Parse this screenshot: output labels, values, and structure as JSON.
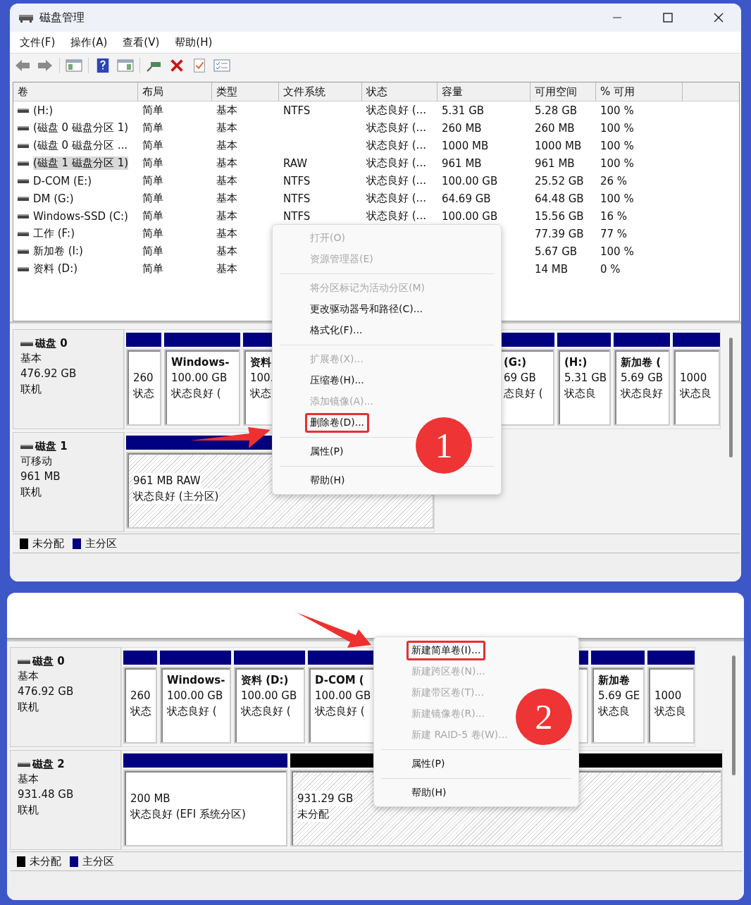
{
  "top_screenshot": {
    "window": {
      "title": "磁盘管理"
    },
    "menu_bar": [
      "文件(F)",
      "操作(A)",
      "查看(V)",
      "帮助(H)"
    ],
    "volume_table": {
      "columns": [
        "卷",
        "布局",
        "类型",
        "文件系统",
        "状态",
        "容量",
        "可用空间",
        "% 可用"
      ],
      "rows": [
        {
          "volume": "(H:)",
          "layout": "简单",
          "type": "基本",
          "file_system": "NTFS",
          "status": "状态良好 (...",
          "capacity": "5.31 GB",
          "free_space": "5.28 GB",
          "percent_free": "100 %",
          "selected": false
        },
        {
          "volume": "(磁盘 0 磁盘分区 1)",
          "layout": "简单",
          "type": "基本",
          "status": "状态良好 (...",
          "capacity": "260 MB",
          "free_space": "260 MB",
          "percent_free": "100 %",
          "selected": false
        },
        {
          "volume": "(磁盘 0 磁盘分区 ...",
          "layout": "简单",
          "type": "基本",
          "status": "状态良好 (...",
          "capacity": "1000 MB",
          "free_space": "1000 MB",
          "percent_free": "100 %",
          "selected": false
        },
        {
          "volume": "(磁盘 1 磁盘分区 1)",
          "layout": "简单",
          "type": "基本",
          "file_system": "RAW",
          "status": "状态良好 (...",
          "capacity": "961 MB",
          "free_space": "961 MB",
          "percent_free": "100 %",
          "selected": true
        },
        {
          "volume": "D-COM (E:)",
          "layout": "简单",
          "type": "基本",
          "file_system": "NTFS",
          "status": "状态良好 (...",
          "capacity": "100.00 GB",
          "free_space": "25.52 GB",
          "percent_free": "26 %",
          "selected": false
        },
        {
          "volume": "DM (G:)",
          "layout": "简单",
          "type": "基本",
          "file_system": "NTFS",
          "status": "状态良好 (...",
          "capacity": "64.69 GB",
          "free_space": "64.48 GB",
          "percent_free": "100 %",
          "selected": false
        },
        {
          "volume": "Windows-SSD (C:)",
          "layout": "简单",
          "type": "基本",
          "file_system": "NTFS",
          "status": "状态良好 (...",
          "capacity": "100.00 GB",
          "free_space": "15.56 GB",
          "percent_free": "16 %",
          "selected": false
        },
        {
          "volume": "工作 (F:)",
          "layout": "简单",
          "type": "基本",
          "free_space": "77.39 GB",
          "percent_free": "77 %",
          "selected": false
        },
        {
          "volume": "新加卷 (I:)",
          "layout": "简单",
          "type": "基本",
          "free_space": "5.67 GB",
          "percent_free": "100 %",
          "selected": false
        },
        {
          "volume": "资料 (D:)",
          "layout": "简单",
          "type": "基本",
          "free_space": "14 MB",
          "percent_free": "0 %",
          "selected": false
        }
      ]
    },
    "disks": [
      {
        "name": "磁盘 0",
        "type": "基本",
        "size": "476.92 GB",
        "status": "联机",
        "partitions": [
          {
            "kind": "primary",
            "selected": false,
            "size": "260",
            "status": "状态"
          },
          {
            "kind": "primary",
            "selected": false,
            "title": "Windows-",
            "size": "100.00 GB",
            "status": "状态良好 ("
          },
          {
            "kind": "primary",
            "selected": false,
            "title": "资料",
            "size": "100.",
            "status": "状态"
          },
          {
            "kind": "primary",
            "selected": false,
            "title": "(G:)",
            "size": "69 GB",
            "status": "态良好 ("
          },
          {
            "kind": "primary",
            "selected": false,
            "title": "(H:)",
            "size": "5.31 GB",
            "status": "状态良"
          },
          {
            "kind": "primary",
            "selected": false,
            "title": "新加卷 (",
            "size": "5.69 GB",
            "status": "状态良好"
          },
          {
            "kind": "primary",
            "selected": false,
            "size": "1000",
            "status": "状态良"
          }
        ]
      },
      {
        "name": "磁盘 1",
        "type": "可移动",
        "size": "961 MB",
        "status": "联机",
        "partitions": [
          {
            "kind": "primary",
            "selected": true,
            "size": "961 MB RAW",
            "status": "状态良好 (主分区)"
          }
        ]
      }
    ],
    "legend": [
      {
        "label": "未分配",
        "color": "#000000"
      },
      {
        "label": "主分区",
        "color": "#000080"
      }
    ],
    "context_menu": [
      {
        "kind": "item",
        "label": "打开(O)",
        "disabled": true,
        "highlighted": false
      },
      {
        "kind": "item",
        "label": "资源管理器(E)",
        "disabled": true,
        "highlighted": false
      },
      {
        "kind": "separator"
      },
      {
        "kind": "item",
        "label": "将分区标记为活动分区(M)",
        "disabled": true,
        "highlighted": false
      },
      {
        "kind": "item",
        "label": "更改驱动器号和路径(C)...",
        "disabled": false,
        "highlighted": false
      },
      {
        "kind": "item",
        "label": "格式化(F)...",
        "disabled": false,
        "highlighted": false
      },
      {
        "kind": "separator"
      },
      {
        "kind": "item",
        "label": "扩展卷(X)...",
        "disabled": true,
        "highlighted": false
      },
      {
        "kind": "item",
        "label": "压缩卷(H)...",
        "disabled": false,
        "highlighted": false
      },
      {
        "kind": "item",
        "label": "添加镜像(A)...",
        "disabled": true,
        "highlighted": false
      },
      {
        "kind": "item",
        "label": "删除卷(D)...",
        "disabled": false,
        "highlighted": true
      },
      {
        "kind": "separator"
      },
      {
        "kind": "item",
        "label": "属性(P)",
        "disabled": false,
        "highlighted": false
      },
      {
        "kind": "separator"
      },
      {
        "kind": "item",
        "label": "帮助(H)",
        "disabled": false,
        "highlighted": false
      }
    ],
    "callout": {
      "number": "1"
    }
  },
  "bottom_screenshot": {
    "disks": [
      {
        "name": "磁盘 0",
        "type": "基本",
        "size": "476.92 GB",
        "status": "联机",
        "partitions": [
          {
            "kind": "primary",
            "selected": false,
            "size": "260",
            "status": "状态"
          },
          {
            "kind": "primary",
            "selected": false,
            "title": "Windows-",
            "size": "100.00 GB",
            "status": "状态良好 ("
          },
          {
            "kind": "primary",
            "selected": false,
            "title": "资料 (D:)",
            "size": "100.00 GB",
            "status": "状态良好 ("
          },
          {
            "kind": "primary",
            "selected": false,
            "title": "D-COM (",
            "size": "100.00 GB",
            "status": "状态良好 ("
          },
          {
            "kind": "primary",
            "selected": false,
            "title": "新加卷",
            "size": "5.69 GE",
            "status": "状态良"
          },
          {
            "kind": "primary",
            "selected": false,
            "size": "1000",
            "status": "状态良"
          }
        ]
      },
      {
        "name": "磁盘 2",
        "type": "基本",
        "size": "931.48 GB",
        "status": "联机",
        "partitions": [
          {
            "kind": "primary",
            "selected": false,
            "size": "200 MB",
            "status": "状态良好 (EFI 系统分区)"
          },
          {
            "kind": "unallocated",
            "selected": true,
            "size": "931.29 GB",
            "status": "未分配"
          }
        ]
      }
    ],
    "legend": [
      {
        "label": "未分配",
        "color": "#000000"
      },
      {
        "label": "主分区",
        "color": "#000080"
      }
    ],
    "context_menu": [
      {
        "kind": "item",
        "label": "新建简单卷(I)...",
        "disabled": false,
        "highlighted": true
      },
      {
        "kind": "item",
        "label": "新建跨区卷(N)...",
        "disabled": true,
        "highlighted": false
      },
      {
        "kind": "item",
        "label": "新建带区卷(T)...",
        "disabled": true,
        "highlighted": false
      },
      {
        "kind": "item",
        "label": "新建镜像卷(R)...",
        "disabled": true,
        "highlighted": false
      },
      {
        "kind": "item",
        "label": "新建 RAID-5 卷(W)...",
        "disabled": true,
        "highlighted": false
      },
      {
        "kind": "separator"
      },
      {
        "kind": "item",
        "label": "属性(P)",
        "disabled": false,
        "highlighted": false
      },
      {
        "kind": "separator"
      },
      {
        "kind": "item",
        "label": "帮助(H)",
        "disabled": false,
        "highlighted": false
      }
    ],
    "callout": {
      "number": "2"
    }
  }
}
